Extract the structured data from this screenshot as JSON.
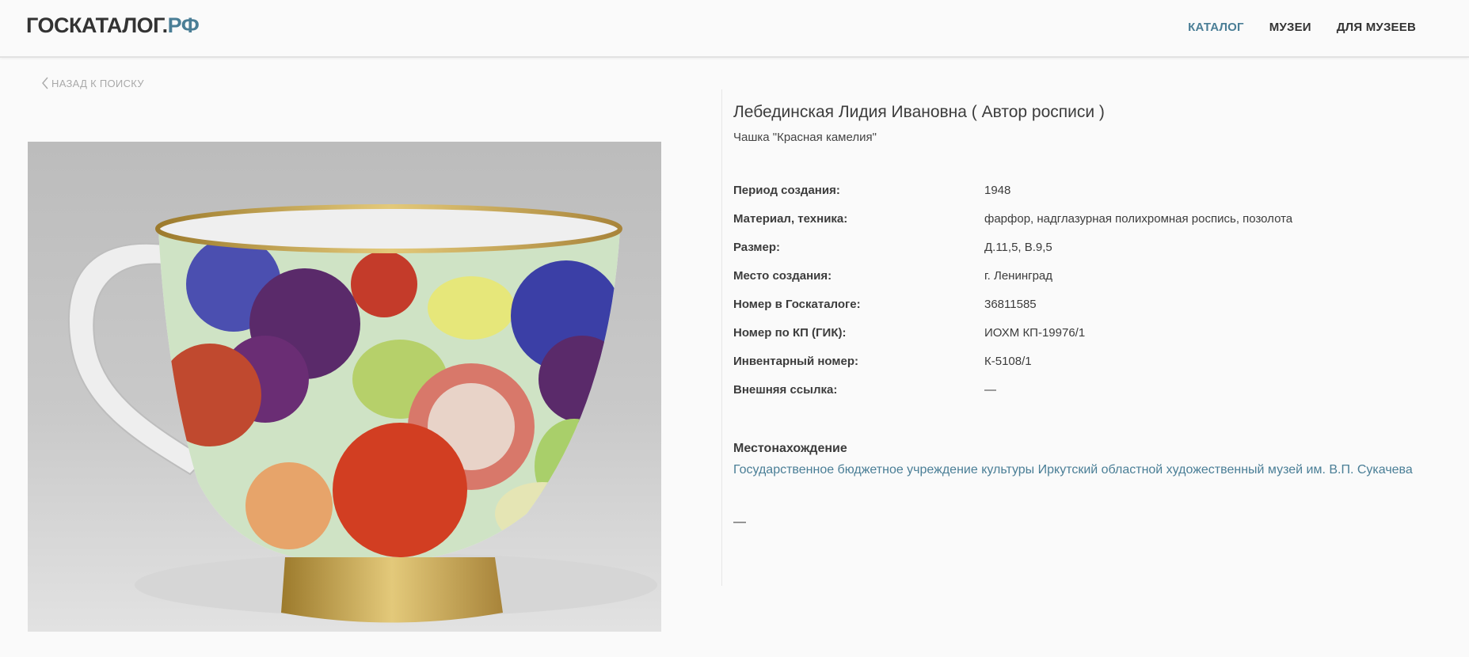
{
  "header": {
    "logo_main": "ГОСКАТАЛОГ.",
    "logo_suffix": "РФ",
    "nav": [
      {
        "label": "КАТАЛОГ",
        "active": true
      },
      {
        "label": "МУЗЕИ",
        "active": false
      },
      {
        "label": "ДЛЯ МУЗЕЕВ",
        "active": false
      }
    ],
    "accent_color": "#4a7e96"
  },
  "back_link": "НАЗАД К ПОИСКУ",
  "item": {
    "author": "Лебединская Лидия Ивановна ( Автор росписи )",
    "title": "Чашка \"Красная камелия\"",
    "properties": [
      {
        "label": "Период создания:",
        "value": "1948"
      },
      {
        "label": "Материал, техника:",
        "value": "фарфор, надглазурная полихромная роспись, позолота"
      },
      {
        "label": "Размер:",
        "value": "Д.11,5, В.9,5"
      },
      {
        "label": "Место создания:",
        "value": "г. Ленинград"
      },
      {
        "label": "Номер в Госкаталоге:",
        "value": "36811585"
      },
      {
        "label": "Номер по КП (ГИК):",
        "value": "ИОХМ КП-19976/1"
      },
      {
        "label": "Инвентарный номер:",
        "value": "К-5108/1"
      },
      {
        "label": "Внешняя ссылка:",
        "value": "—"
      }
    ],
    "location_title": "Местонахождение",
    "location_link": "Государственное бюджетное учреждение культуры Иркутский областной художественный музей им. В.П. Сукачева",
    "extra": "—"
  }
}
